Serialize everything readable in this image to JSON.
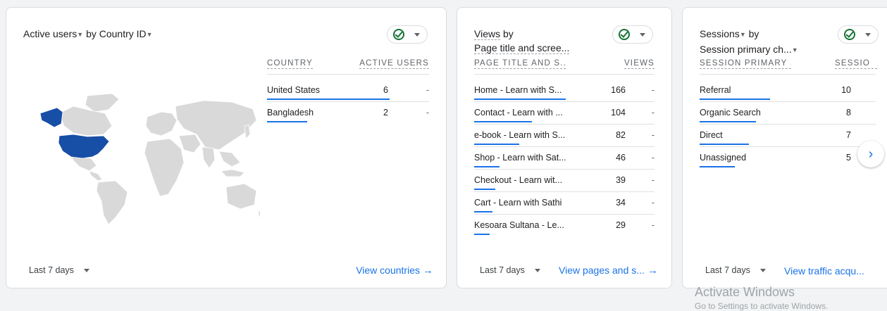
{
  "colors": {
    "accent": "#1a73e8",
    "map_highlight": "#174ea6",
    "map_base": "#d9d9d9",
    "ok_green": "#137333"
  },
  "card1": {
    "metric": "Active users",
    "by": "by",
    "dimension": "Country ID",
    "columns": [
      "COUNTRY",
      "ACTIVE USERS"
    ],
    "rows": [
      {
        "name": "United States",
        "value": "6",
        "dash": "-",
        "share": 1.0
      },
      {
        "name": "Bangladesh",
        "value": "2",
        "dash": "-",
        "share": 0.33
      }
    ],
    "date_range": "Last 7 days",
    "link": "View countries"
  },
  "card2": {
    "metric": "Views",
    "by": "by",
    "dimension": "Page title and scree...",
    "columns": [
      "PAGE TITLE AND S...",
      "VIEWS"
    ],
    "rows": [
      {
        "name": "Home - Learn with S...",
        "value": "166",
        "dash": "-",
        "share": 1.0
      },
      {
        "name": "Contact - Learn with ...",
        "value": "104",
        "dash": "-",
        "share": 0.63
      },
      {
        "name": "e-book - Learn with S...",
        "value": "82",
        "dash": "-",
        "share": 0.49
      },
      {
        "name": "Shop - Learn with Sat...",
        "value": "46",
        "dash": "-",
        "share": 0.28
      },
      {
        "name": "Checkout - Learn wit...",
        "value": "39",
        "dash": "-",
        "share": 0.23
      },
      {
        "name": "Cart - Learn with Sathi",
        "value": "34",
        "dash": "-",
        "share": 0.2
      },
      {
        "name": "Kesoara Sultana - Le...",
        "value": "29",
        "dash": "-",
        "share": 0.17
      }
    ],
    "date_range": "Last 7 days",
    "link": "View pages and s..."
  },
  "card3": {
    "metric": "Sessions",
    "by": "by",
    "dimension": "Session primary ch...",
    "columns": [
      "SESSION PRIMARY ...",
      "SESSIO"
    ],
    "rows": [
      {
        "name": "Referral",
        "value": "10",
        "share": 1.0
      },
      {
        "name": "Organic Search",
        "value": "8",
        "share": 0.8
      },
      {
        "name": "Direct",
        "value": "7",
        "share": 0.7
      },
      {
        "name": "Unassigned",
        "value": "5",
        "share": 0.5
      }
    ],
    "date_range": "Last 7 days",
    "link": "View traffic acqu..."
  },
  "next_icon": "chevron-right-icon",
  "watermark": {
    "title": "Activate Windows",
    "subtitle": "Go to Settings to activate Windows."
  }
}
